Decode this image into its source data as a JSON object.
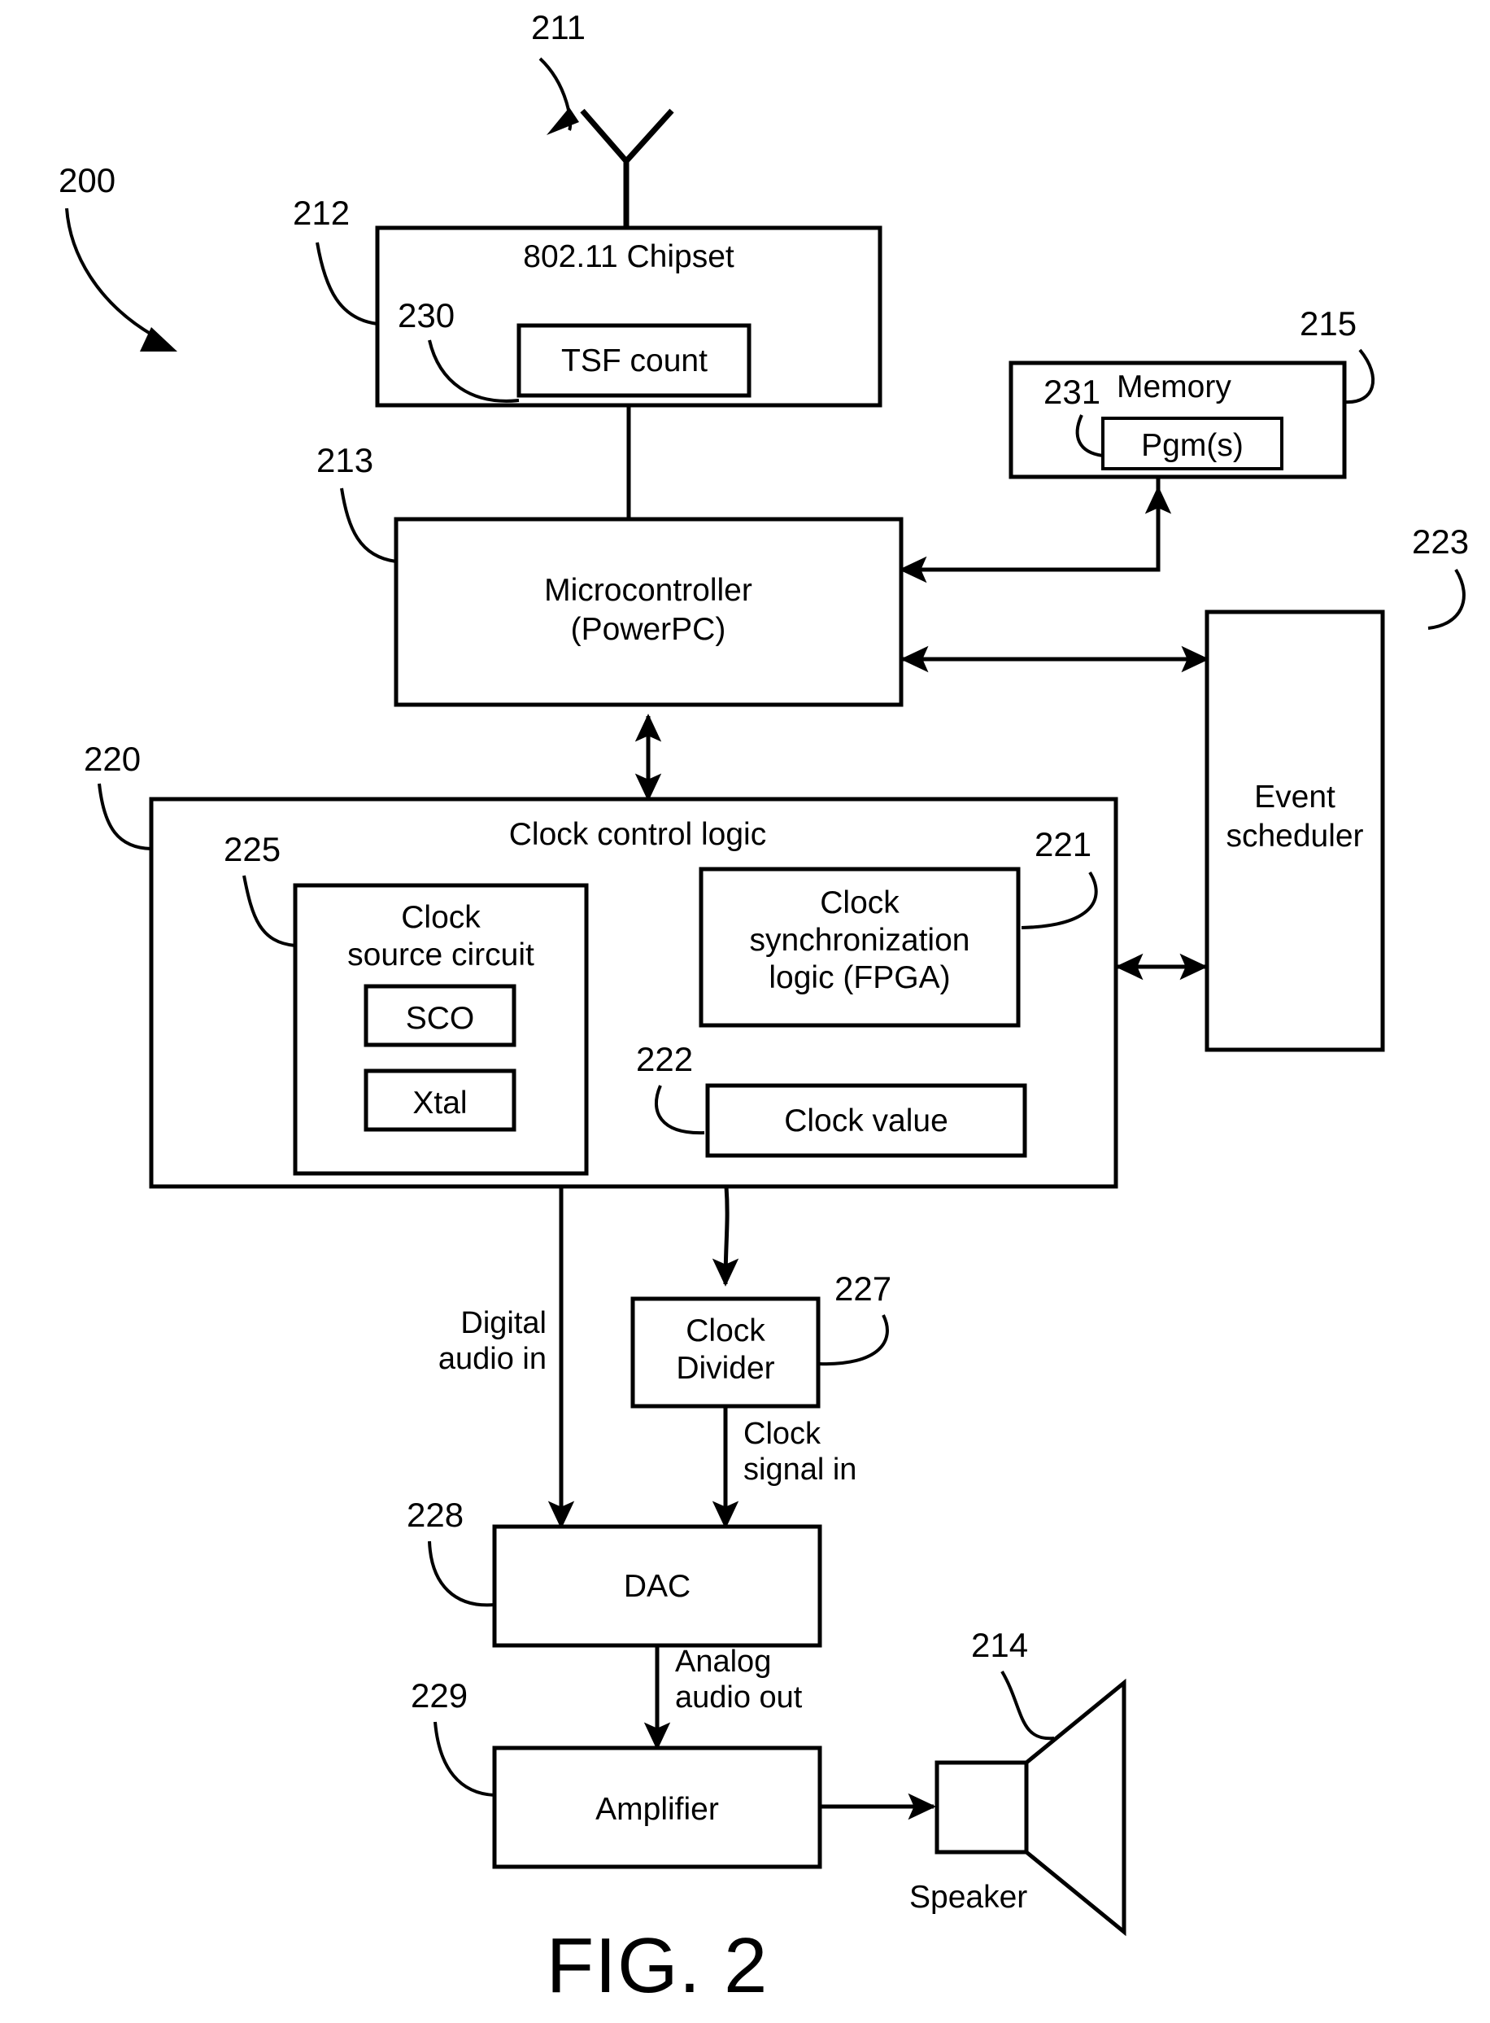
{
  "figure": {
    "caption": "FIG. 2",
    "system_ref": "200"
  },
  "blocks": {
    "chipset": {
      "label": "802.11 Chipset",
      "ref": "212",
      "inner": {
        "label": "TSF count",
        "ref": "230"
      }
    },
    "memory": {
      "label": "Memory",
      "ref": "215",
      "inner": {
        "label": "Pgm(s)",
        "ref": "231"
      }
    },
    "microcontroller": {
      "line1": "Microcontroller",
      "line2": "(PowerPC)",
      "ref": "213"
    },
    "event_scheduler": {
      "line1": "Event",
      "line2": "scheduler",
      "ref": "223"
    },
    "clock_control_logic": {
      "label": "Clock control logic",
      "ref": "220"
    },
    "clock_source_circuit": {
      "line1": "Clock",
      "line2": "source circuit",
      "ref": "225",
      "sco": "SCO",
      "xtal": "Xtal"
    },
    "clock_sync_logic": {
      "line1": "Clock",
      "line2": "synchronization",
      "line3": "logic (FPGA)",
      "ref": "221"
    },
    "clock_value": {
      "label": "Clock value",
      "ref": "222"
    },
    "clock_divider": {
      "line1": "Clock",
      "line2": "Divider",
      "ref": "227"
    },
    "dac": {
      "label": "DAC",
      "ref": "228"
    },
    "amplifier": {
      "label": "Amplifier",
      "ref": "229"
    },
    "speaker": {
      "label": "Speaker",
      "ref": "214"
    },
    "antenna": {
      "ref": "211"
    }
  },
  "signals": {
    "digital_audio_in_l1": "Digital",
    "digital_audio_in_l2": "audio in",
    "clock_signal_in_l1": "Clock",
    "clock_signal_in_l2": "signal in",
    "analog_audio_out_l1": "Analog",
    "analog_audio_out_l2": "audio out"
  },
  "colors": {
    "stroke": "#000000",
    "background": "#ffffff"
  }
}
